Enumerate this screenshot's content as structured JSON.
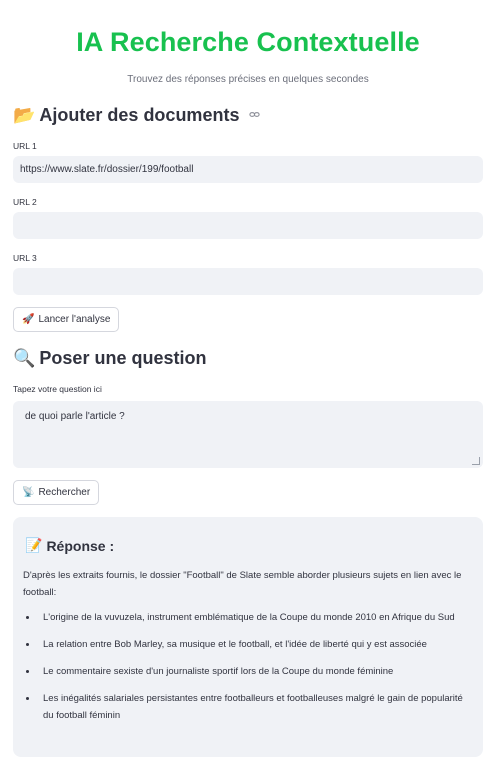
{
  "header": {
    "title": "IA Recherche Contextuelle",
    "subtitle": "Trouvez des réponses précises en quelques secondes"
  },
  "documents": {
    "heading_icon": "📂",
    "heading": "Ajouter des documents",
    "link_icon": "⊖",
    "url1_label": "URL 1",
    "url1_value": "https://www.slate.fr/dossier/199/football",
    "url2_label": "URL 2",
    "url2_value": "",
    "url3_label": "URL 3",
    "url3_value": "",
    "analyze_icon": "🚀",
    "analyze_label": "Lancer l'analyse"
  },
  "question": {
    "heading_icon": "🔍",
    "heading": "Poser une question",
    "input_label": "Tapez votre question ici",
    "input_value": "de quoi parle l'article ?",
    "search_icon": "📡",
    "search_label": "Rechercher"
  },
  "answer": {
    "title_icon": "📝",
    "title": "Réponse :",
    "intro": "D'après les extraits fournis, le dossier \"Football\" de Slate semble aborder plusieurs sujets en lien avec le football:",
    "items": [
      "L'origine de la vuvuzela, instrument emblématique de la Coupe du monde 2010 en Afrique du Sud",
      "La relation entre Bob Marley, sa musique et le football, et l'idée de liberté qui y est associée",
      "Le commentaire sexiste d'un journaliste sportif lors de la Coupe du monde féminine",
      "Les inégalités salariales persistantes entre footballeurs et footballeuses malgré le gain de popularité du football féminin"
    ]
  }
}
